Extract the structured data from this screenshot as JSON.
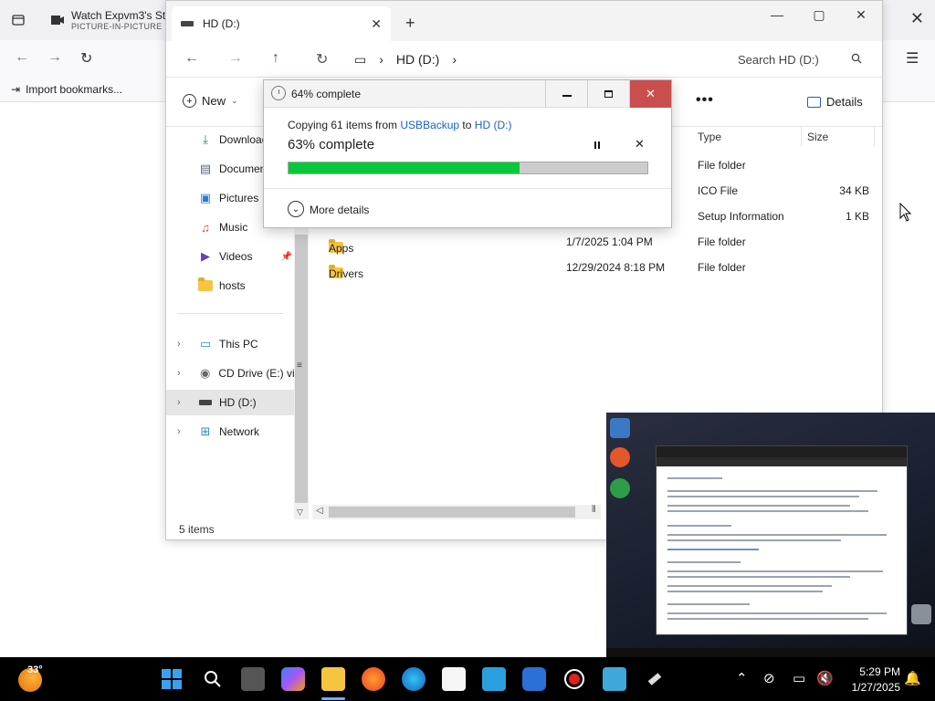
{
  "browser": {
    "tab_title": "Watch Expvm3's Str",
    "tab_subtitle": "PICTURE-IN-PICTURE",
    "bookmark": "Import bookmarks..."
  },
  "explorer": {
    "tab_label": "HD (D:)",
    "breadcrumb": "HD (D:)",
    "search_placeholder": "Search HD (D:)",
    "new_label": "New",
    "details_label": "Details",
    "nav": {
      "quick": [
        {
          "label": "Downloads",
          "icon": "download-icon"
        },
        {
          "label": "Documents",
          "icon": "documents-icon"
        },
        {
          "label": "Pictures",
          "icon": "pictures-icon"
        },
        {
          "label": "Music",
          "icon": "music-icon"
        },
        {
          "label": "Videos",
          "icon": "videos-icon"
        },
        {
          "label": "hosts",
          "icon": "folder-icon"
        }
      ],
      "tree": [
        {
          "label": "This PC",
          "icon": "this-pc-icon"
        },
        {
          "label": "CD Drive (E:) virt",
          "icon": "cd-drive-icon"
        },
        {
          "label": "HD (D:)",
          "icon": "drive-icon"
        },
        {
          "label": "Network",
          "icon": "network-icon"
        }
      ]
    },
    "columns": {
      "type": "Type",
      "size": "Size"
    },
    "rows": [
      {
        "name": "",
        "date": "",
        "type": "File folder",
        "size": ""
      },
      {
        "name": "",
        "date": "",
        "type": "ICO File",
        "size": "34 KB"
      },
      {
        "name": "",
        "date": "",
        "type": "Setup Information",
        "size": "1 KB"
      },
      {
        "name": "Apps",
        "date": "1/7/2025 1:04 PM",
        "type": "File folder",
        "size": ""
      },
      {
        "name": "Drivers",
        "date": "12/29/2024 8:18 PM",
        "type": "File folder",
        "size": ""
      }
    ],
    "status": "5 items"
  },
  "copy_dialog": {
    "title": "64% complete",
    "line_prefix": "Copying 61 items from ",
    "source": "USBBackup",
    "line_mid": " to ",
    "destination": "HD (D:)",
    "percent_text": "63% complete",
    "progress": 0.645,
    "more_details": "More details",
    "progress_color": "#06c83a"
  },
  "taskbar": {
    "temperature": "33°",
    "time": "5:29 PM",
    "date": "1/27/2025"
  }
}
